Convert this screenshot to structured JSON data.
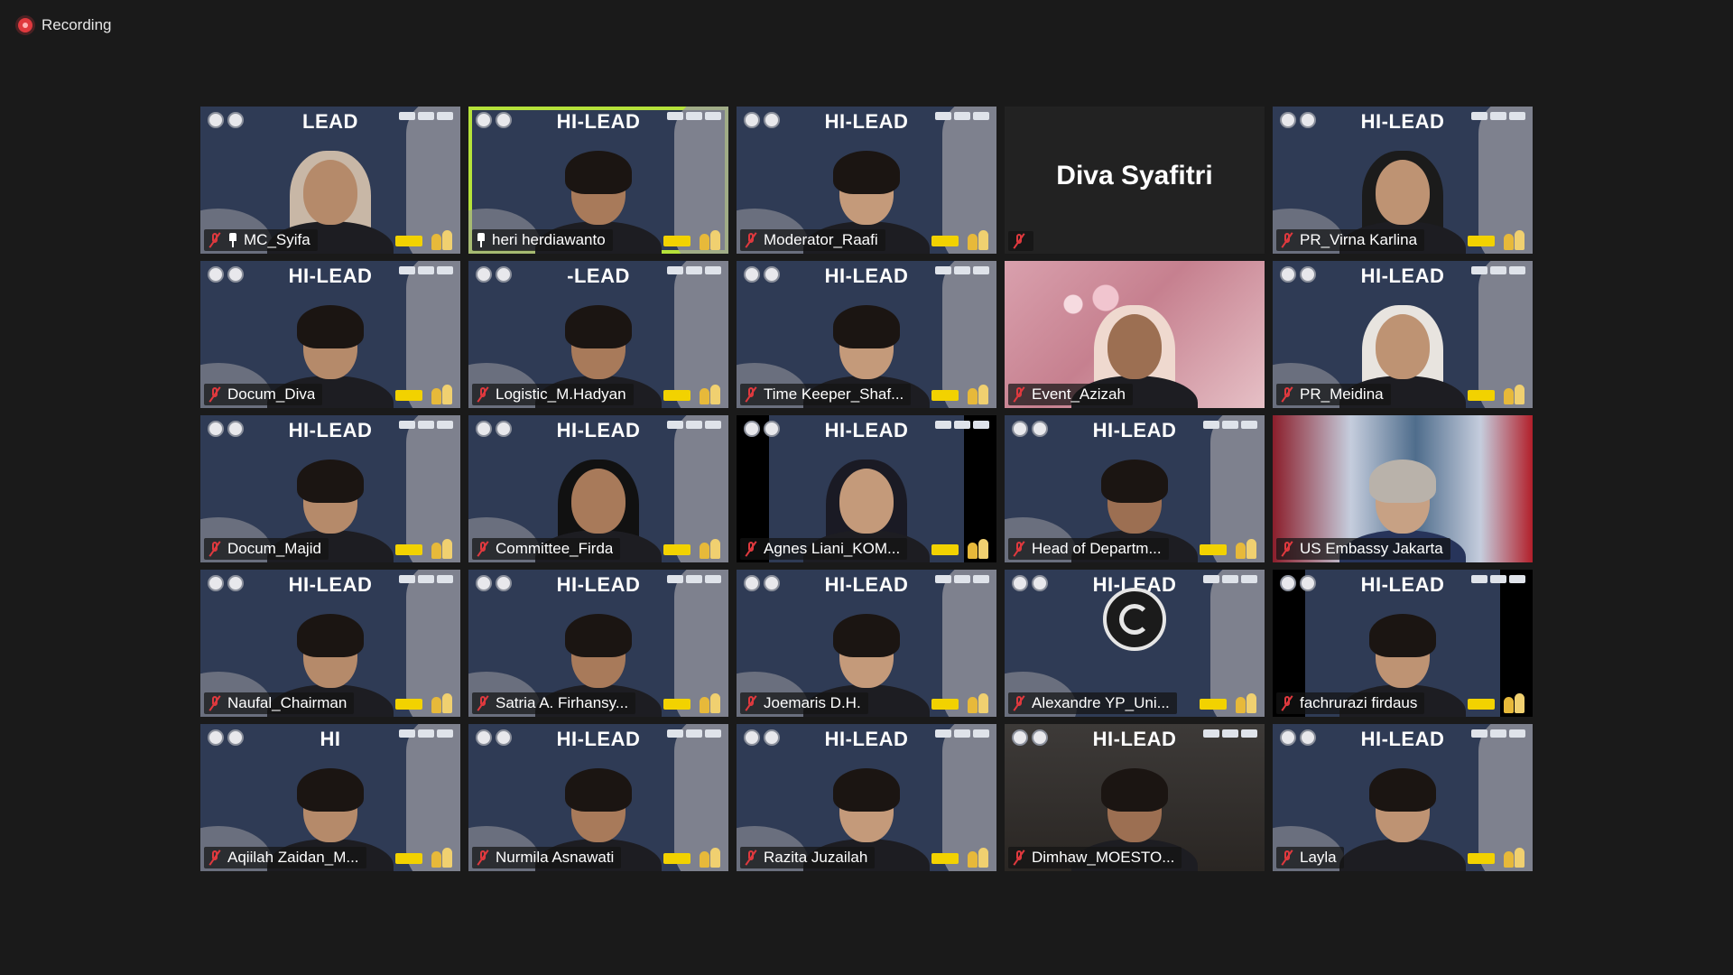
{
  "recording": {
    "label": "Recording"
  },
  "colors": {
    "background": "#1a1a1a",
    "tile_blue": "#2f3b55",
    "active_speaker_border": "#b5e23a",
    "muted_red": "#e0393e",
    "badge_yellow": "#f2d200"
  },
  "banner_text": "HI-LEAD",
  "participants": [
    {
      "name": "MC_Syifa",
      "muted": true,
      "pinned": true,
      "background": "hilead",
      "hilead_text": "LEAD"
    },
    {
      "name": "heri herdiawanto",
      "muted": false,
      "pinned": true,
      "active_speaker": true,
      "background": "hilead",
      "hilead_text": "HI-LEAD"
    },
    {
      "name": "Moderator_Raafi",
      "muted": true,
      "background": "hilead",
      "hilead_text": "HI-LEAD"
    },
    {
      "name": "Diva Syafitri",
      "muted": true,
      "video_off": true,
      "name_only": "Diva Syafitri"
    },
    {
      "name": "PR_Virna Karlina",
      "muted": true,
      "background": "hilead",
      "hilead_text": "HI-LEAD"
    },
    {
      "name": "Docum_Diva",
      "muted": true,
      "background": "hilead",
      "hilead_text": "HI-LEAD"
    },
    {
      "name": "Logistic_M.Hadyan",
      "muted": true,
      "background": "hilead",
      "hilead_text": "-LEAD"
    },
    {
      "name": "Time Keeper_Shaf...",
      "muted": true,
      "background": "hilead",
      "hilead_text": "HI-LEAD"
    },
    {
      "name": "Event_Azizah",
      "muted": true,
      "background": "pink"
    },
    {
      "name": "PR_Meidina",
      "muted": true,
      "background": "hilead",
      "hilead_text": "HI-LEAD"
    },
    {
      "name": "Docum_Majid",
      "muted": true,
      "background": "hilead",
      "hilead_text": "HI-LEAD"
    },
    {
      "name": "Committee_Firda",
      "muted": true,
      "background": "hilead",
      "hilead_text": "HI-LEAD"
    },
    {
      "name": "Agnes Liani_KOM...",
      "muted": true,
      "background": "black-sides",
      "hilead_text": "HI-LEAD"
    },
    {
      "name": "Head of Departm...",
      "muted": true,
      "background": "hilead",
      "hilead_text": "HI-LEAD"
    },
    {
      "name": "US Embassy Jakarta",
      "muted": true,
      "background": "flag"
    },
    {
      "name": "Naufal_Chairman",
      "muted": true,
      "background": "hilead",
      "hilead_text": "HI-LEAD"
    },
    {
      "name": "Satria A. Firhansy...",
      "muted": true,
      "background": "hilead",
      "hilead_text": "HI-LEAD"
    },
    {
      "name": "Joemaris D.H.",
      "muted": true,
      "background": "hilead",
      "hilead_text": "HI-LEAD"
    },
    {
      "name": "Alexandre YP_Uni...",
      "muted": true,
      "background": "hilead",
      "hilead_text": "HI-LEAD",
      "obs_logo": true
    },
    {
      "name": "fachrurazi firdaus",
      "muted": true,
      "background": "black-sides",
      "hilead_text": "HI-LEAD"
    },
    {
      "name": "Aqiilah Zaidan_M...",
      "muted": true,
      "background": "hilead",
      "hilead_text": "HI"
    },
    {
      "name": "Nurmila Asnawati",
      "muted": true,
      "background": "hilead",
      "hilead_text": "HI-LEAD"
    },
    {
      "name": "Razita Juzailah",
      "muted": true,
      "background": "hilead",
      "hilead_text": "HI-LEAD"
    },
    {
      "name": "Dimhaw_MOESTO...",
      "muted": true,
      "background": "room",
      "hilead_text": "HI-LEAD"
    },
    {
      "name": "Layla",
      "muted": true,
      "background": "hilead",
      "hilead_text": "HI-LEAD"
    }
  ],
  "icons": {
    "muted_mic": "mic-muted-icon",
    "pin": "pin-icon",
    "recording": "recording-dot-icon"
  }
}
